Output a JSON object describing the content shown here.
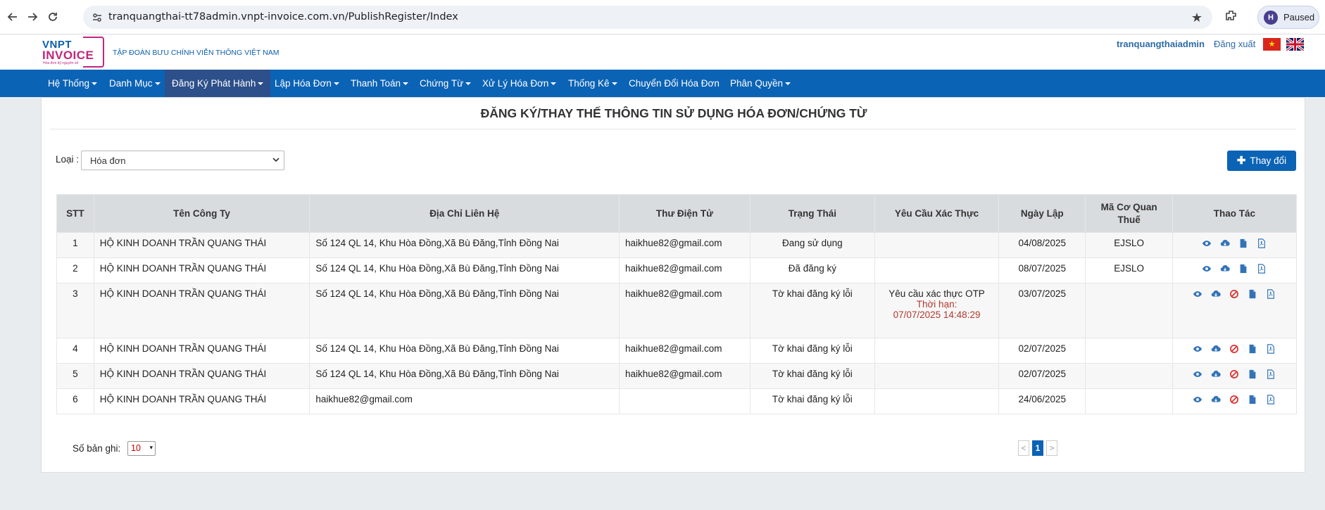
{
  "browser": {
    "url": "tranquangthai-tt78admin.vnpt-invoice.com.vn/PublishRegister/Index",
    "profile_initial": "H",
    "profile_status": "Paused"
  },
  "header": {
    "logo_top": "VNPT",
    "logo_bottom": "INVOICE",
    "logo_tagline": "Hóa đơn kỹ nguyên số",
    "corporation": "TẬP  ĐOÀN BƯU CHÍNH VIỄN THÔNG VIỆT NAM",
    "username": "tranquangthaiadmin",
    "logout": "Đăng xuất",
    "star": "★"
  },
  "menu": [
    {
      "label": "Hệ Thống",
      "dropdown": true
    },
    {
      "label": "Danh Mục",
      "dropdown": true
    },
    {
      "label": "Đăng Ký Phát Hành",
      "dropdown": true,
      "active": true
    },
    {
      "label": "Lập Hóa Đơn",
      "dropdown": true
    },
    {
      "label": "Thanh Toán",
      "dropdown": true
    },
    {
      "label": "Chứng Từ",
      "dropdown": true
    },
    {
      "label": "Xử Lý Hóa Đơn",
      "dropdown": true
    },
    {
      "label": "Thống Kê",
      "dropdown": true
    },
    {
      "label": "Chuyển Đổi Hóa Đơn",
      "dropdown": false
    },
    {
      "label": "Phân Quyền",
      "dropdown": true
    }
  ],
  "page": {
    "title": "ĐĂNG KÝ/THAY THẾ THÔNG TIN SỬ DỤNG HÓA ĐƠN/CHỨNG TỪ",
    "filter_label": "Loại :",
    "filter_value": "Hóa đơn",
    "change_button": "Thay đổi"
  },
  "table": {
    "columns": [
      "STT",
      "Tên Công Ty",
      "Địa Chỉ Liên Hệ",
      "Thư Điện Tử",
      "Trạng Thái",
      "Yêu Cầu Xác Thực",
      "Ngày Lập",
      "Mã Cơ Quan Thuế",
      "Thao Tác"
    ],
    "rows": [
      {
        "stt": "1",
        "company": "HỘ KINH DOANH TRẦN QUANG THÁI",
        "address": "Số 124 QL 14, Khu Hòa Đồng,Xã Bù Đăng,Tỉnh Đồng Nai",
        "email": "haikhue82@gmail.com",
        "status": "Đang sử dụng",
        "status_type": "green",
        "verify": "",
        "verify_deadline_label": "",
        "verify_deadline": "",
        "date": "04/08/2025",
        "tax_code": "EJSLO",
        "actions": [
          "view-icon",
          "cloud-download-icon",
          "file-icon",
          "pdf-icon"
        ]
      },
      {
        "stt": "2",
        "company": "HỘ KINH DOANH TRẦN QUANG THÁI",
        "address": "Số 124 QL 14, Khu Hòa Đồng,Xã Bù Đăng,Tỉnh Đồng Nai",
        "email": "haikhue82@gmail.com",
        "status": "Đã đăng ký",
        "status_type": "orange",
        "verify": "",
        "verify_deadline_label": "",
        "verify_deadline": "",
        "date": "08/07/2025",
        "tax_code": "EJSLO",
        "actions": [
          "view-icon",
          "cloud-download-icon",
          "file-icon",
          "pdf-icon"
        ]
      },
      {
        "stt": "3",
        "company": "HỘ KINH DOANH TRẦN QUANG THÁI",
        "address": "Số 124 QL 14, Khu Hòa Đồng,Xã Bù Đăng,Tỉnh Đồng Nai",
        "email": "haikhue82@gmail.com",
        "status": "Tờ khai đăng ký lỗi",
        "status_type": "red",
        "verify": "Yêu cầu xác thực OTP",
        "verify_deadline_label": "Thời hạn:",
        "verify_deadline": "07/07/2025 14:48:29",
        "date": "03/07/2025",
        "tax_code": "",
        "actions": [
          "view-icon",
          "cloud-download-icon",
          "cancel-icon",
          "file-icon",
          "pdf-icon"
        ]
      },
      {
        "stt": "4",
        "company": "HỘ KINH DOANH TRẦN QUANG THÁI",
        "address": "Số 124 QL 14, Khu Hòa Đồng,Xã Bù Đăng,Tỉnh Đồng Nai",
        "email": "haikhue82@gmail.com",
        "status": "Tờ khai đăng ký lỗi",
        "status_type": "red",
        "verify": "",
        "verify_deadline_label": "",
        "verify_deadline": "",
        "date": "02/07/2025",
        "tax_code": "",
        "actions": [
          "view-icon",
          "cloud-download-icon",
          "cancel-icon",
          "file-icon",
          "pdf-icon"
        ]
      },
      {
        "stt": "5",
        "company": "HỘ KINH DOANH TRẦN QUANG THÁI",
        "address": "Số 124 QL 14, Khu Hòa Đồng,Xã Bù Đăng,Tỉnh Đồng Nai",
        "email": "haikhue82@gmail.com",
        "status": "Tờ khai đăng ký lỗi",
        "status_type": "red",
        "verify": "",
        "verify_deadline_label": "",
        "verify_deadline": "",
        "date": "02/07/2025",
        "tax_code": "",
        "actions": [
          "view-icon",
          "cloud-download-icon",
          "cancel-icon",
          "file-icon",
          "pdf-icon"
        ]
      },
      {
        "stt": "6",
        "company": "HỘ KINH DOANH TRẦN QUANG THÁI",
        "address": "haikhue82@gmail.com",
        "email": "",
        "status": "Tờ khai đăng ký lỗi",
        "status_type": "red",
        "verify": "",
        "verify_deadline_label": "",
        "verify_deadline": "",
        "date": "24/06/2025",
        "tax_code": "",
        "actions": [
          "view-icon",
          "cloud-download-icon",
          "cancel-icon",
          "file-icon",
          "pdf-icon"
        ]
      }
    ]
  },
  "pagination": {
    "records_label": "Số bản ghi:",
    "records_value": "10",
    "prev": "<",
    "current_page": "1",
    "next": ">"
  },
  "colors": {
    "brand_blue": "#0b63b5",
    "status_green": "#3a8a3a",
    "status_orange": "#b07a2a",
    "status_red": "#c0392b"
  }
}
